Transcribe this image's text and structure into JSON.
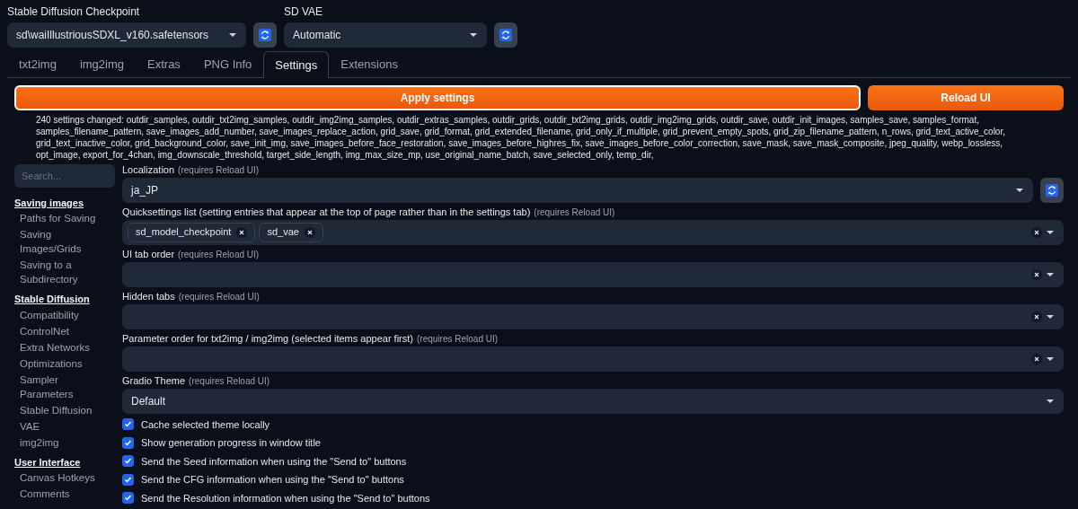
{
  "quicksettings": [
    {
      "label": "Stable Diffusion Checkpoint",
      "value": "sd\\waiIllustriousSDXL_v160.safetensors"
    },
    {
      "label": "SD VAE",
      "value": "Automatic"
    }
  ],
  "tabs": [
    {
      "label": "txt2img",
      "selected": false
    },
    {
      "label": "img2img",
      "selected": false
    },
    {
      "label": "Extras",
      "selected": false
    },
    {
      "label": "PNG Info",
      "selected": false
    },
    {
      "label": "Settings",
      "selected": true
    },
    {
      "label": "Extensions",
      "selected": false
    }
  ],
  "apply_button": "Apply settings",
  "reload_button": "Reload UI",
  "changed_message": "240 settings changed: outdir_samples, outdir_txt2img_samples, outdir_img2img_samples, outdir_extras_samples, outdir_grids, outdir_txt2img_grids, outdir_img2img_grids, outdir_save, outdir_init_images, samples_save, samples_format, samples_filename_pattern, save_images_add_number, save_images_replace_action, grid_save, grid_format, grid_extended_filename, grid_only_if_multiple, grid_prevent_empty_spots, grid_zip_filename_pattern, n_rows, grid_text_active_color, grid_text_inactive_color, grid_background_color, save_init_img, save_images_before_face_restoration, save_images_before_highres_fix, save_images_before_color_correction, save_mask, save_mask_composite, jpeg_quality, webp_lossless, opt_image, export_for_4chan, img_downscale_threshold, target_side_length, img_max_size_mp, use_original_name_batch, save_selected_only, temp_dir,",
  "sidebar": {
    "search_placeholder": "Search...",
    "sections": [
      {
        "title": "Saving images",
        "items": [
          "Paths for Saving",
          "Saving Images/Grids",
          "Saving to a Subdirectory"
        ]
      },
      {
        "title": "Stable Diffusion",
        "items": [
          "Compatibility",
          "ControlNet",
          "Extra Networks",
          "Optimizations",
          "Sampler Parameters",
          "Stable Diffusion",
          "VAE",
          "img2img"
        ]
      },
      {
        "title": "User Interface",
        "items": [
          "Canvas Hotkeys",
          "Comments"
        ]
      }
    ]
  },
  "settings": [
    {
      "kind": "select",
      "label": "Localization",
      "note": "(requires Reload UI)",
      "value": "ja_JP",
      "refresh": true
    },
    {
      "kind": "multiselect",
      "label": "Quicksettings list (setting entries that appear at the top of page rather than in the settings tab)",
      "note": "(requires Reload UI)",
      "chips": [
        "sd_model_checkpoint",
        "sd_vae"
      ]
    },
    {
      "kind": "multiselect",
      "label": "UI tab order",
      "note": "(requires Reload UI)"
    },
    {
      "kind": "multiselect",
      "label": "Hidden tabs",
      "note": "(requires Reload UI)"
    },
    {
      "kind": "multiselect",
      "label": "Parameter order for txt2img / img2img (selected items appear first)",
      "note": "(requires Reload UI)"
    },
    {
      "kind": "select",
      "label": "Gradio Theme",
      "note": "(requires Reload UI)",
      "value": "Default",
      "refresh": false
    },
    {
      "kind": "checkbox",
      "label": "Cache selected theme locally",
      "checked": true
    },
    {
      "kind": "checkbox",
      "label": "Show generation progress in window title",
      "checked": true
    },
    {
      "kind": "checkbox",
      "label": "Send the Seed information when using the \"Send to\" buttons",
      "checked": true
    },
    {
      "kind": "checkbox",
      "label": "Send the CFG information when using the \"Send to\" buttons",
      "checked": true
    },
    {
      "kind": "checkbox",
      "label": "Send the Resolution information when using the \"Send to\" buttons",
      "checked": true
    }
  ]
}
